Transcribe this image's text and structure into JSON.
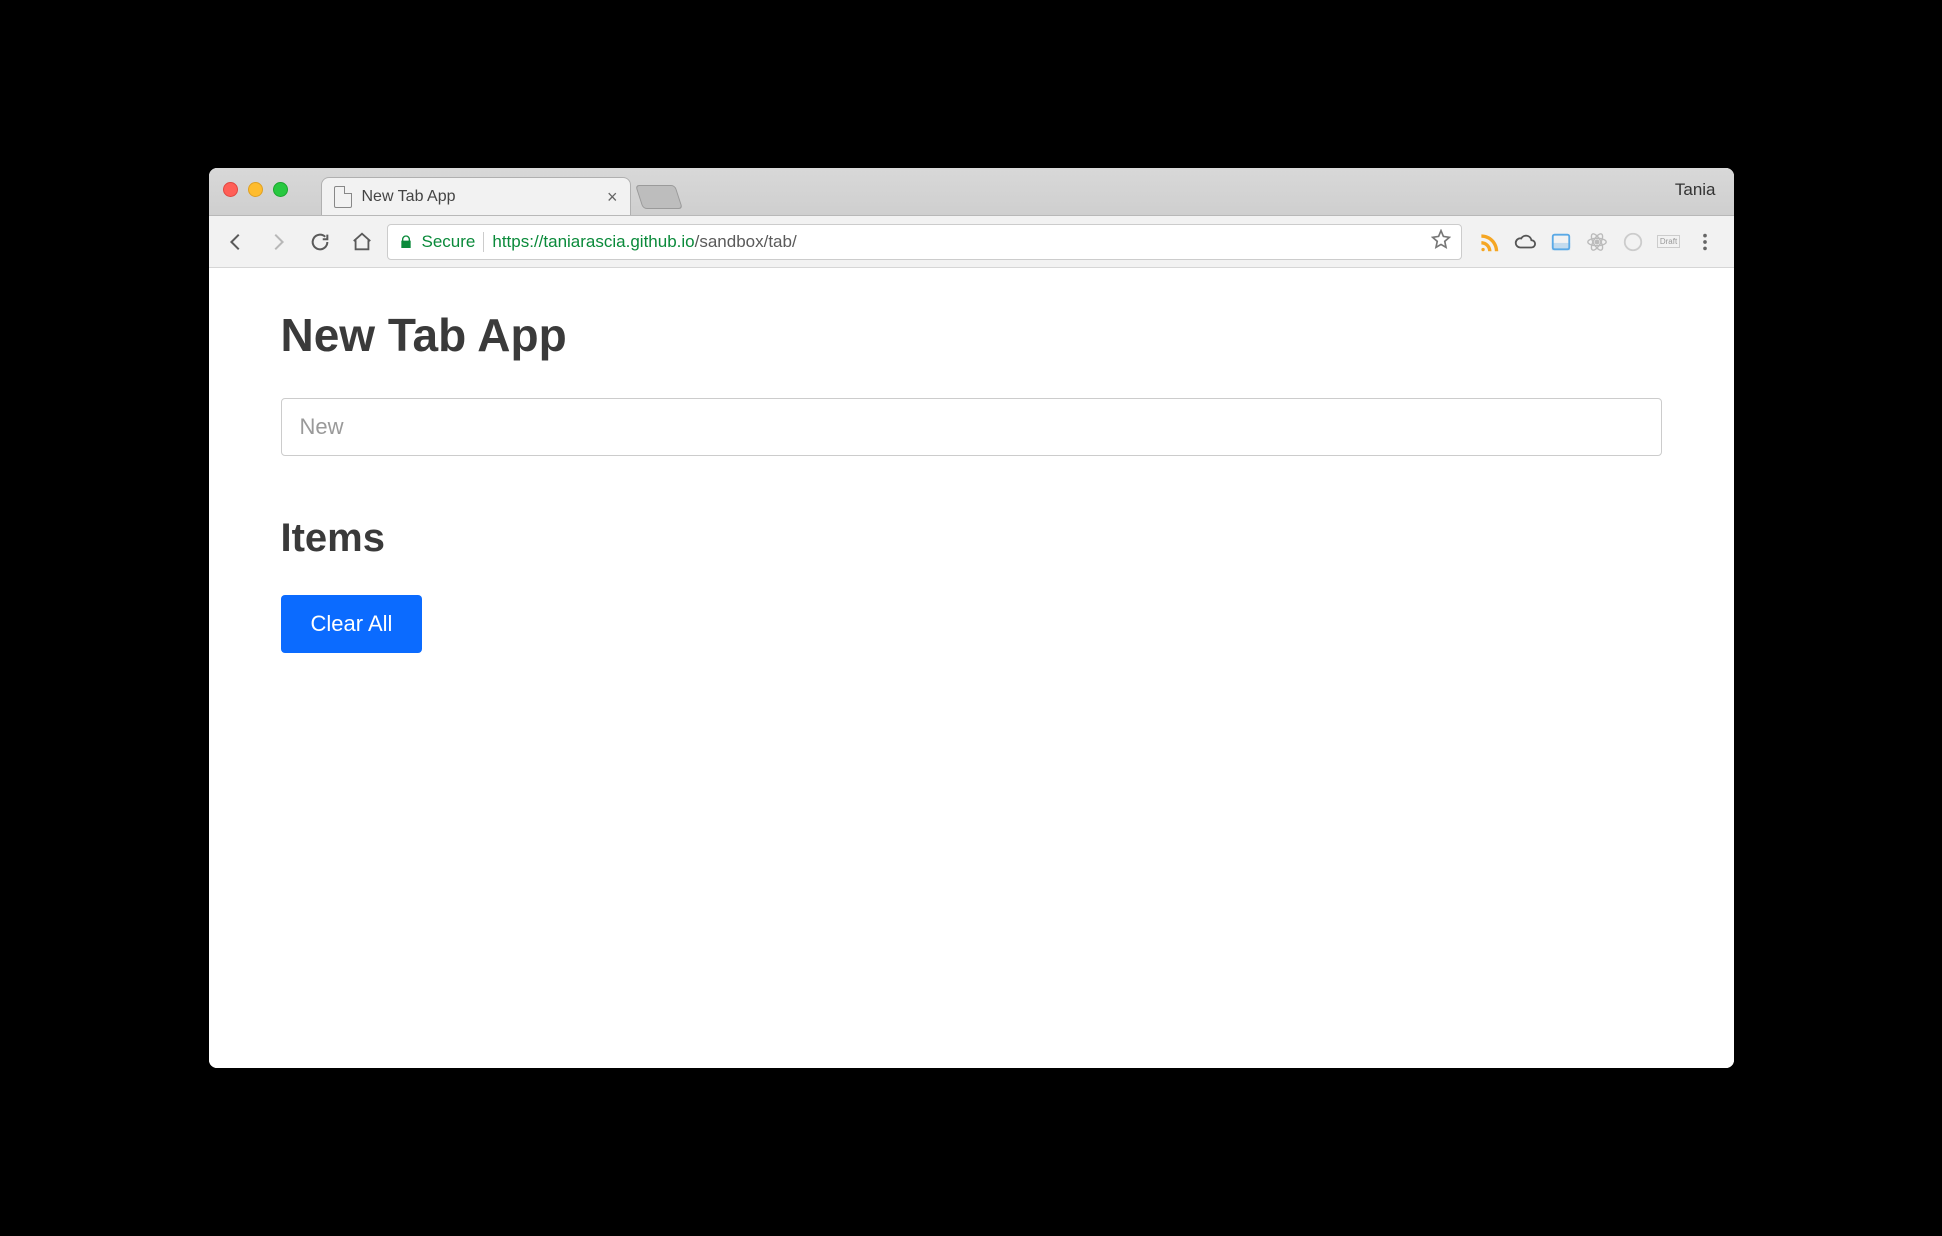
{
  "window": {
    "profile_name": "Tania"
  },
  "tab": {
    "title": "New Tab App"
  },
  "toolbar": {
    "secure_label": "Secure",
    "url_scheme_host": "https://taniarascia.github.io",
    "url_path": "/sandbox/tab/"
  },
  "app": {
    "title": "New Tab App",
    "input_placeholder": "New",
    "input_value": "",
    "items_heading": "Items",
    "clear_all_label": "Clear All"
  }
}
